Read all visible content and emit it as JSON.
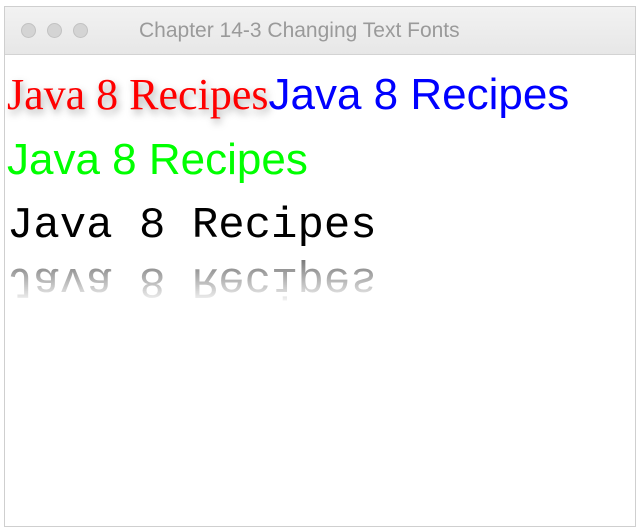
{
  "window": {
    "title": "Chapter 14-3 Changing Text Fonts"
  },
  "content": {
    "text_serif_red": "Java 8 Recipes",
    "text_sans_blue": "Java 8 Recipes",
    "text_sans_green": "Java 8 Recipes",
    "text_mono_black": "Java 8 Recipes",
    "text_mono_reflection": "Java 8 Recipes"
  },
  "colors": {
    "red": "#ff0000",
    "blue": "#0000ff",
    "green": "#00ff00",
    "black": "#000000"
  },
  "icons": {
    "window_controls": [
      "close-icon",
      "minimize-icon",
      "zoom-icon"
    ]
  }
}
